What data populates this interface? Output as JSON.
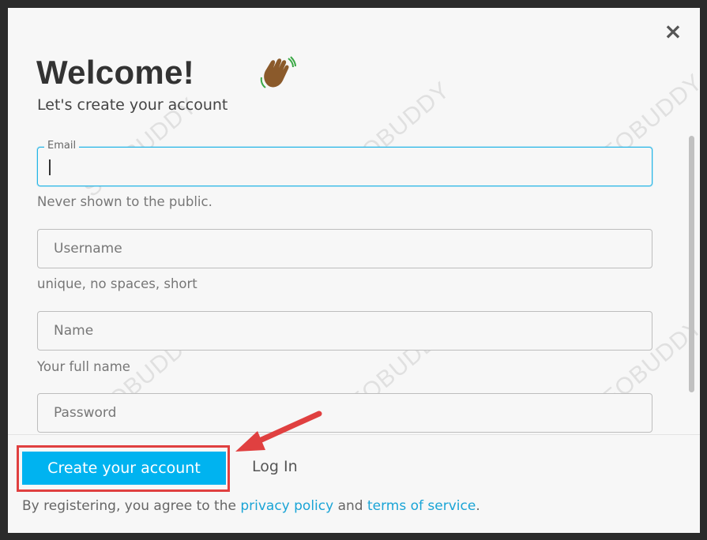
{
  "dialog": {
    "close_symbol": "×",
    "title": "Welcome!",
    "subtitle": "Let's create your account",
    "wave_icon": "waving-hand-icon"
  },
  "form": {
    "email": {
      "label": "Email",
      "value": "",
      "hint": "Never shown to the public."
    },
    "username": {
      "placeholder": "Username",
      "hint": "unique, no spaces, short"
    },
    "name": {
      "placeholder": "Name",
      "hint": "Your full name"
    },
    "password": {
      "placeholder": "Password"
    }
  },
  "footer": {
    "create_label": "Create your account",
    "login_label": "Log In",
    "terms_prefix": "By registering, you agree to the ",
    "privacy_label": "privacy policy",
    "terms_mid": " and ",
    "tos_label": "terms of service",
    "terms_suffix": "."
  },
  "watermark": {
    "text": "SEOBUDDY"
  },
  "colors": {
    "accent": "#00b3f0",
    "link": "#1aa4d6",
    "focus_border": "#23b5e6",
    "annotation_red": "#e04040"
  }
}
